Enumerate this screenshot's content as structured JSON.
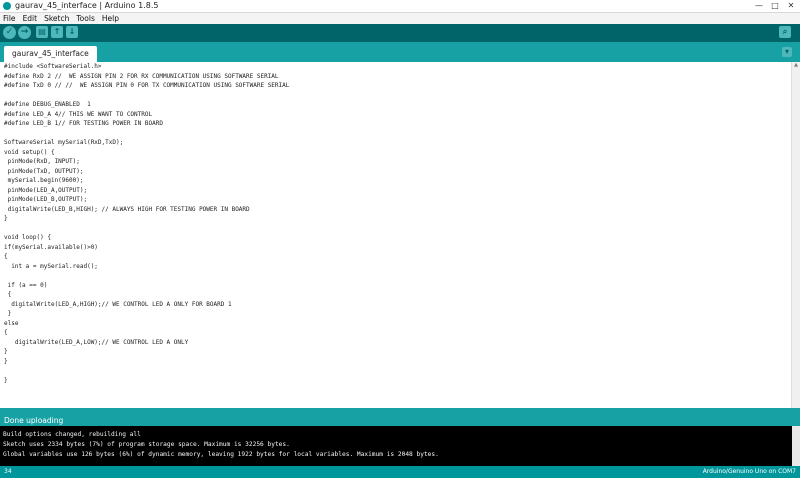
{
  "window": {
    "title": "gaurav_45_interface | Arduino 1.8.5",
    "minimize": "—",
    "maximize": "□",
    "close": "✕"
  },
  "menu": [
    "File",
    "Edit",
    "Sketch",
    "Tools",
    "Help"
  ],
  "toolbar": {
    "verify_icon": "✓",
    "upload_icon": "→",
    "new_icon": "▤",
    "open_icon": "↑",
    "save_icon": "↓",
    "serial_monitor_icon": "⌕"
  },
  "tabs": [
    {
      "label": "gaurav_45_interface"
    }
  ],
  "tab_menu_icon": "▾",
  "code": {
    "lines": [
      "#include <SoftwareSerial.h>",
      "#define RxD 2 //  WE ASSIGN PIN 2 FOR RX COMMUNICATION USING SOFTWARE SERIAL",
      "#define TxD 0 // //  WE ASSIGN PIN 0 FOR TX COMMUNICATION USING SOFTWARE SERIAL",
      "",
      "#define DEBUG_ENABLED  1",
      "#define LED_A 4// THIS WE WANT TO CONTROL",
      "#define LED_B 1// FOR TESTING POWER IN BOARD",
      "",
      "SoftwareSerial mySerial(RxD,TxD);",
      "void setup() {",
      " pinMode(RxD, INPUT);",
      " pinMode(TxD, OUTPUT);",
      " mySerial.begin(9600);",
      " pinMode(LED_A,OUTPUT);",
      " pinMode(LED_B,OUTPUT);",
      " digitalWrite(LED_B,HIGH); // ALWAYS HIGH FOR TESTING POWER IN BOARD",
      "}",
      "",
      "void loop() {",
      "if(mySerial.available()>0)",
      "{",
      "  int a = mySerial.read();",
      "",
      " if (a == 0)",
      " {",
      "  digitalWrite(LED_A,HIGH);// WE CONTROL LED A ONLY FOR BOARD 1",
      " }",
      "else",
      "{",
      "   digitalWrite(LED_A,LOW);// WE CONTROL LED A ONLY",
      "}",
      "}",
      "",
      "}"
    ]
  },
  "status": {
    "message": "Done uploading"
  },
  "console": {
    "lines": [
      "Build options changed, rebuilding all",
      "Sketch uses 2334 bytes (7%) of program storage space. Maximum is 32256 bytes.",
      "Global variables use 126 bytes (6%) of dynamic memory, leaving 1922 bytes for local variables. Maximum is 2048 bytes."
    ]
  },
  "footer": {
    "line_number": "34",
    "board": "Arduino/Genuino Uno on COM7"
  },
  "colors": {
    "toolbar_dark": "#006468",
    "tab_bar": "#17a1a5",
    "status_bar": "#17a1a5",
    "footer": "#00979c",
    "console_bg": "#000000"
  }
}
